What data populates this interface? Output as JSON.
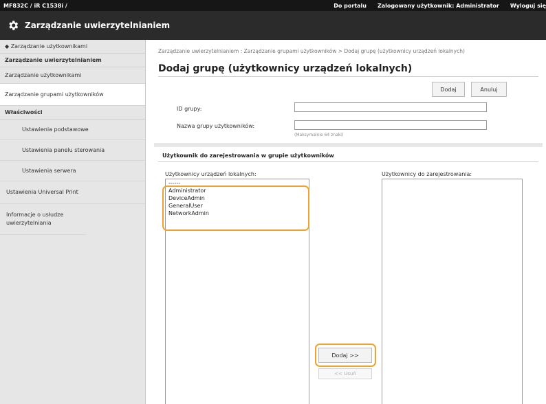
{
  "topbar": {
    "device": "MF832C / iR C1538i /",
    "portal": "Do portalu",
    "logged_user": "Zalogowany użytkownik: Administrator",
    "logout": "Wyloguj się"
  },
  "app": {
    "title": "Zarządzanie uwierzytelnianiem",
    "icon": "gear-icon"
  },
  "sidebar": {
    "back": "◆ Zarządzanie użytkownikami",
    "section1": "Zarządzanie uwierzytelnianiem",
    "items1": [
      "Zarządzanie użytkownikami",
      "Zarządzanie grupami użytkowników"
    ],
    "section2": "Właściwości",
    "items2": [
      "Ustawienia podstawowe",
      "Ustawienia panelu sterowania",
      "Ustawienia serwera"
    ],
    "items3": [
      "Ustawienia Universal Print",
      "Informacje o usłudze uwierzytelniania"
    ]
  },
  "main": {
    "breadcrumb": "Zarządzanie uwierzytelnianiem : Zarządzanie grupami użytkowników > Dodaj grupę (użytkownicy urządzeń lokalnych)",
    "title": "Dodaj grupę (użytkownicy urządzeń lokalnych)",
    "add_button": "Dodaj",
    "cancel_button": "Anuluj",
    "group_id_label": "ID grupy:",
    "group_id_value": "",
    "group_name_label": "Nazwa grupy użytkowników:",
    "group_name_value": "",
    "group_name_hint": "(Maksymalnie 64 znaki)",
    "section_title": "Użytkownik do zarejestrowania w grupie użytkowników",
    "local_users_label": "Użytkownicy urządzeń lokalnych:",
    "local_users": [
      "------",
      "Administrator",
      "DeviceAdmin",
      "GeneralUser",
      "NetworkAdmin"
    ],
    "register_label": "Użytkownicy do zarejestrowania:",
    "register_users": [],
    "add_arrow_button": "Dodaj >>",
    "remove_button": "<< Usuń"
  },
  "colors": {
    "highlight": "#f0a22e",
    "topbar": "#161616",
    "titlebar": "#2b2b2b",
    "sidebar": "#e6e6e6"
  }
}
